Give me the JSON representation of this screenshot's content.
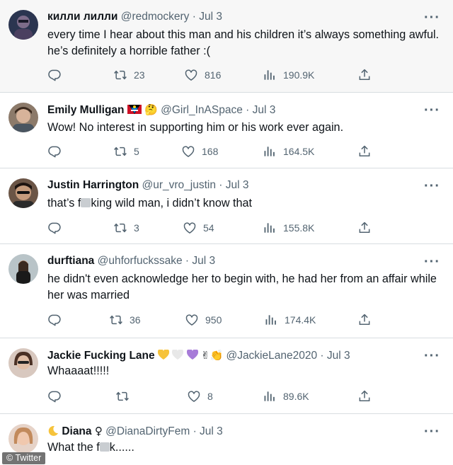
{
  "tweets": [
    {
      "name": "килли лилли",
      "handle": "@redmockery",
      "date": "Jul 3",
      "text": "every time I hear about this man and his children it’s always something awful. he’s definitely a horrible father :(",
      "retweets": "23",
      "likes": "816",
      "views": "190.9K"
    },
    {
      "name": "Emily Mulligan",
      "handle": "@Girl_InASpace",
      "date": "Jul 3",
      "text": "Wow! No interest in supporting him or his work ever again.",
      "retweets": "5",
      "likes": "168",
      "views": "164.5K"
    },
    {
      "name": "Justin Harrington",
      "handle": "@ur_vro_justin",
      "date": "Jul 3",
      "text_a": "that’s f",
      "text_b": "king wild man, i didn’t know that",
      "retweets": "3",
      "likes": "54",
      "views": "155.8K"
    },
    {
      "name": "durftiana",
      "handle": "@uhforfuckssake",
      "date": "Jul 3",
      "text": "he didn't even acknowledge her to begin with, he had her from an affair while her was married",
      "retweets": "36",
      "likes": "950",
      "views": "174.4K"
    },
    {
      "name": "Jackie Fucking Lane",
      "handle": "@JackieLane2020",
      "date": "Jul 3",
      "text": "Whaaaat!!!!!",
      "retweets": "",
      "likes": "8",
      "views": "89.6K"
    },
    {
      "name": "Diana",
      "handle": "@DianaDirtyFem",
      "date": "Jul 3",
      "text_a": "What the f",
      "text_b": "k......"
    }
  ],
  "separator": "·",
  "more_label": "···",
  "watermark": "© Twitter",
  "icons": {
    "reply": "reply-icon",
    "retweet": "retweet-icon",
    "like": "heart-icon",
    "views": "views-icon",
    "share": "share-icon"
  },
  "emojis": {
    "emily": [
      "flag-emoji",
      "thinking-face-emoji"
    ],
    "jackie": [
      "yellow-heart-emoji",
      "white-heart-emoji",
      "purple-heart-emoji",
      "victory-hand-emoji",
      "clapping-hand-emoji"
    ],
    "diana": [
      "crescent-moon-emoji",
      "female-sign-symbol"
    ]
  },
  "colors": {
    "text": "#0f1419",
    "secondary": "#536471",
    "divider": "#d8dde1",
    "highlight_bg": "#f7f7f7"
  }
}
